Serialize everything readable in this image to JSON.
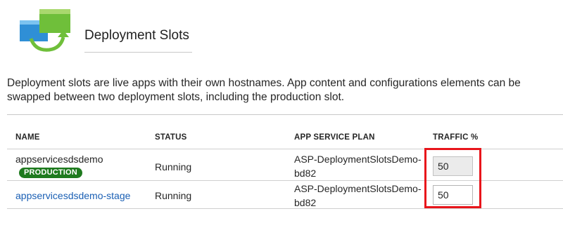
{
  "header": {
    "title": "Deployment Slots",
    "icon": "deployment-slots-icon"
  },
  "description": "Deployment slots are live apps with their own hostnames. App content and configurations elements can be swapped between two deployment slots, including the production slot.",
  "table": {
    "columns": [
      "NAME",
      "STATUS",
      "APP SERVICE PLAN",
      "TRAFFIC %"
    ],
    "rows": [
      {
        "name": "appservicesdsdemo",
        "badge": "PRODUCTION",
        "status": "Running",
        "plan_line1": "ASP-DeploymentSlotsDemo-",
        "plan_line2": "bd82",
        "traffic": "50",
        "traffic_editable": false
      },
      {
        "name": "appservicesdsdemo-stage",
        "status": "Running",
        "plan_line1": "ASP-DeploymentSlotsDemo-",
        "plan_line2": "bd82",
        "traffic": "50",
        "traffic_editable": true
      }
    ]
  },
  "colors": {
    "accent_link": "#1a5fb4",
    "badge_green": "#1e7a1e",
    "highlight_red": "#e8151b"
  }
}
